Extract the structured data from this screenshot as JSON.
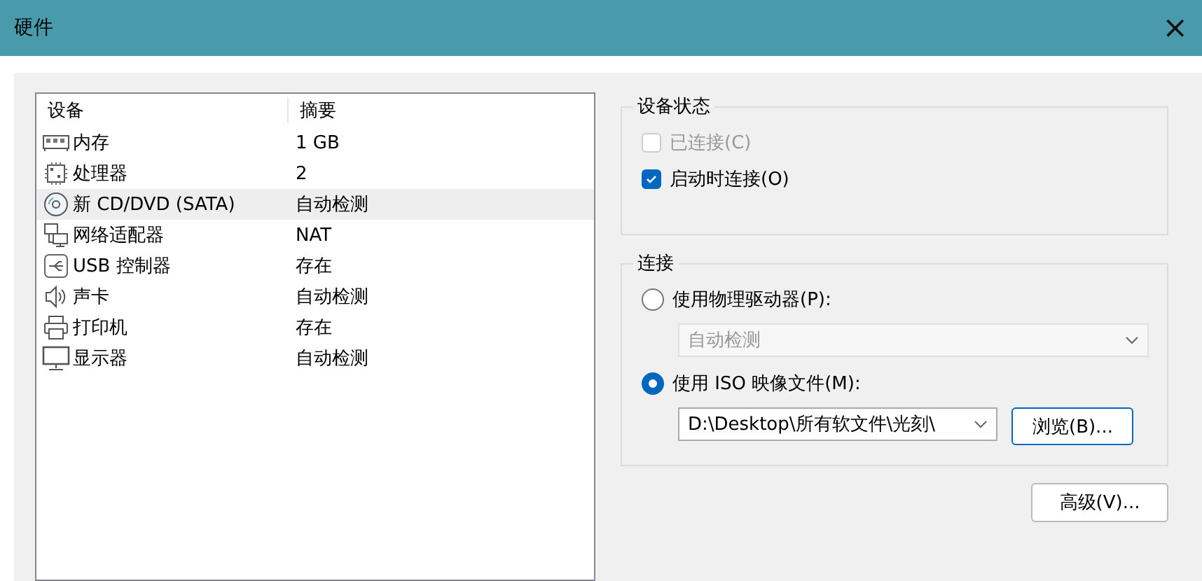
{
  "window": {
    "title": "硬件",
    "close": "×"
  },
  "device_list": {
    "columns": [
      "设备",
      "摘要"
    ],
    "rows": [
      {
        "kind": "memory",
        "device": "内存",
        "summary": "1 GB",
        "selected": false
      },
      {
        "kind": "cpu",
        "device": "处理器",
        "summary": "2",
        "selected": false
      },
      {
        "kind": "cd",
        "device": "新 CD/DVD (SATA)",
        "summary": "自动检测",
        "selected": true
      },
      {
        "kind": "network",
        "device": "网络适配器",
        "summary": "NAT",
        "selected": false
      },
      {
        "kind": "usb",
        "device": "USB 控制器",
        "summary": "存在",
        "selected": false
      },
      {
        "kind": "sound",
        "device": "声卡",
        "summary": "自动检测",
        "selected": false
      },
      {
        "kind": "printer",
        "device": "打印机",
        "summary": "存在",
        "selected": false
      },
      {
        "kind": "display",
        "device": "显示器",
        "summary": "自动检测",
        "selected": false
      }
    ]
  },
  "device_status": {
    "legend": "设备状态",
    "options": [
      {
        "label": "已连接(C)",
        "checked": false,
        "disabled": true
      },
      {
        "label": "启动时连接(O)",
        "checked": true,
        "disabled": false
      }
    ]
  },
  "connection": {
    "legend": "连接",
    "physical": {
      "label": "使用物理驱动器(P):",
      "selected": false,
      "drive": "自动检测",
      "disabled": true
    },
    "iso": {
      "label": "使用 ISO 映像文件(M):",
      "selected": true,
      "path": "D:\\Desktop\\所有软文件\\光刻\\",
      "browse": "浏览(B)..."
    }
  },
  "advanced_button": "高级(V)..."
}
